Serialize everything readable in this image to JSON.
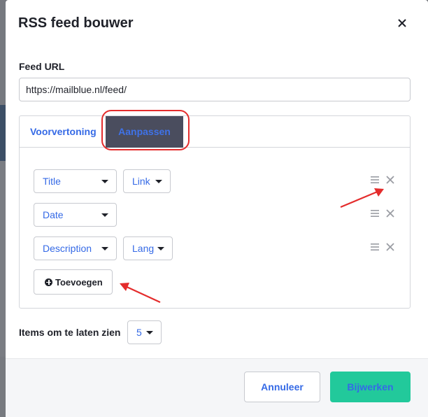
{
  "modal": {
    "title": "RSS feed bouwer",
    "close_icon": "close-icon"
  },
  "feed_url": {
    "label": "Feed URL",
    "value": "https://mailblue.nl/feed/"
  },
  "tabs": [
    {
      "label": "Voorvertoning",
      "active": false
    },
    {
      "label": "Aanpassen",
      "active": true
    }
  ],
  "rows": [
    {
      "fields": [
        "Title",
        "Link"
      ],
      "icons": [
        "drag-handle-icon",
        "remove-icon"
      ]
    },
    {
      "fields": [
        "Date"
      ],
      "icons": [
        "drag-handle-icon",
        "remove-icon"
      ]
    },
    {
      "fields": [
        "Description",
        "Lang"
      ],
      "icons": [
        "drag-handle-icon",
        "remove-icon"
      ]
    }
  ],
  "add_button": {
    "label": "Toevoegen",
    "icon": "plus-circle-icon"
  },
  "items": {
    "label": "Items om te laten zien",
    "value": "5"
  },
  "footer": {
    "cancel_label": "Annuleer",
    "update_label": "Bijwerken"
  },
  "colors": {
    "link_blue": "#356ae6",
    "primary_green": "#22c99b",
    "highlight_red": "#e42c2c",
    "active_tab_bg": "#4a4d5e"
  }
}
